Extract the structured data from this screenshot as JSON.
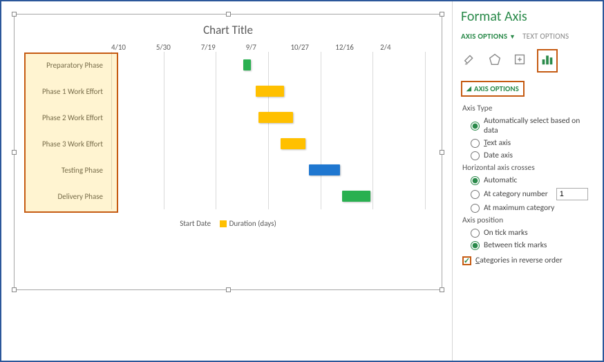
{
  "chart_data": {
    "type": "bar",
    "orientation": "horizontal",
    "title": "Chart Title",
    "x_ticks": [
      "4/10",
      "5/30",
      "7/19",
      "9/7",
      "10/27",
      "12/16",
      "2/4"
    ],
    "categories": [
      "Preparatory Phase",
      "Phase 1 Work Effort",
      "Phase 2 Work Effort",
      "Phase 3 Work Effort",
      "Testing Phase",
      "Delivery Phase"
    ],
    "series": [
      {
        "name": "Start Date",
        "color": null
      },
      {
        "name": "Duration (days)",
        "color": "#ffc000"
      }
    ],
    "bars": [
      {
        "category": "Preparatory Phase",
        "left_pct": 42.0,
        "width_pct": 2.5,
        "color": "green"
      },
      {
        "category": "Phase 1 Work Effort",
        "left_pct": 46.0,
        "width_pct": 9.0,
        "color": "yellow"
      },
      {
        "category": "Phase 2 Work Effort",
        "left_pct": 47.0,
        "width_pct": 11.0,
        "color": "yellow"
      },
      {
        "category": "Phase 3 Work Effort",
        "left_pct": 54.0,
        "width_pct": 8.0,
        "color": "yellow"
      },
      {
        "category": "Testing Phase",
        "left_pct": 63.0,
        "width_pct": 10.0,
        "color": "blue"
      },
      {
        "category": "Delivery Phase",
        "left_pct": 73.5,
        "width_pct": 9.0,
        "color": "green"
      }
    ],
    "legend": {
      "label_start": "Start Date",
      "label_duration": "Duration (days)"
    }
  },
  "panel": {
    "title": "Format Axis",
    "tabs": {
      "axis_options": "AXIS OPTIONS",
      "text_options": "TEXT OPTIONS"
    },
    "section_header": "AXIS OPTIONS",
    "axis_type": {
      "label": "Axis Type",
      "auto": "Automatically select based on data",
      "text": "Text axis",
      "date": "Date axis"
    },
    "h_crosses": {
      "label": "Horizontal axis crosses",
      "auto": "Automatic",
      "at_cat": "At category number",
      "at_cat_value": "1",
      "at_max": "At maximum category"
    },
    "axis_position": {
      "label": "Axis position",
      "on_tick": "On tick marks",
      "between": "Between tick marks"
    },
    "reverse": "Categories in reverse order"
  }
}
